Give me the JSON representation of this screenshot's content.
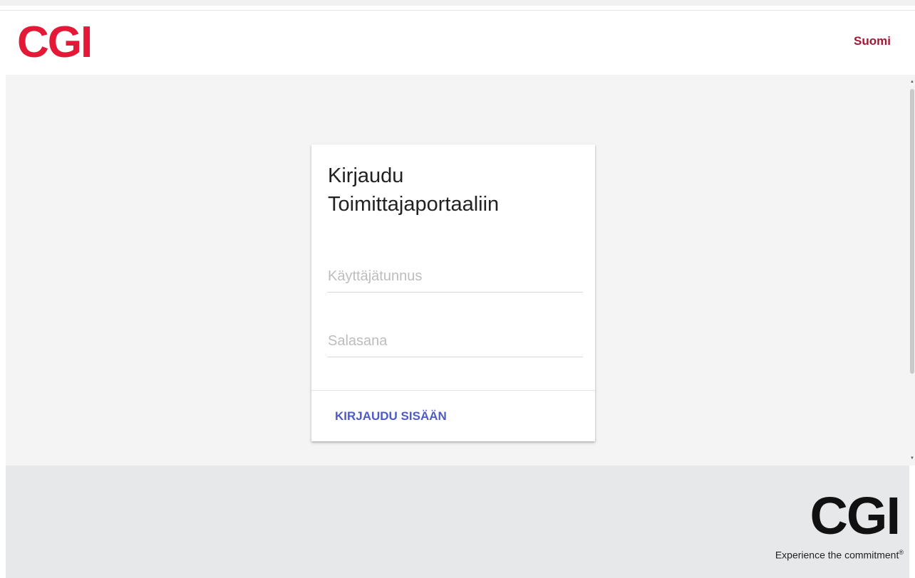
{
  "header": {
    "logo_text": "CGI",
    "language_label": "Suomi"
  },
  "login_card": {
    "title": "Kirjaudu Toimittajaportaaliin",
    "username_placeholder": "Käyttäjätunnus",
    "password_placeholder": "Salasana",
    "submit_label": "KIRJAUDU SISÄÄN"
  },
  "footer": {
    "logo_text": "CGI",
    "tagline": "Experience the commitment",
    "tagline_mark": "®"
  },
  "colors": {
    "brand_red": "#e31937",
    "language_link": "#a01835",
    "button_text": "#4f5bc4",
    "page_background": "#f4f4f4",
    "footer_background": "#e6e8ea"
  }
}
